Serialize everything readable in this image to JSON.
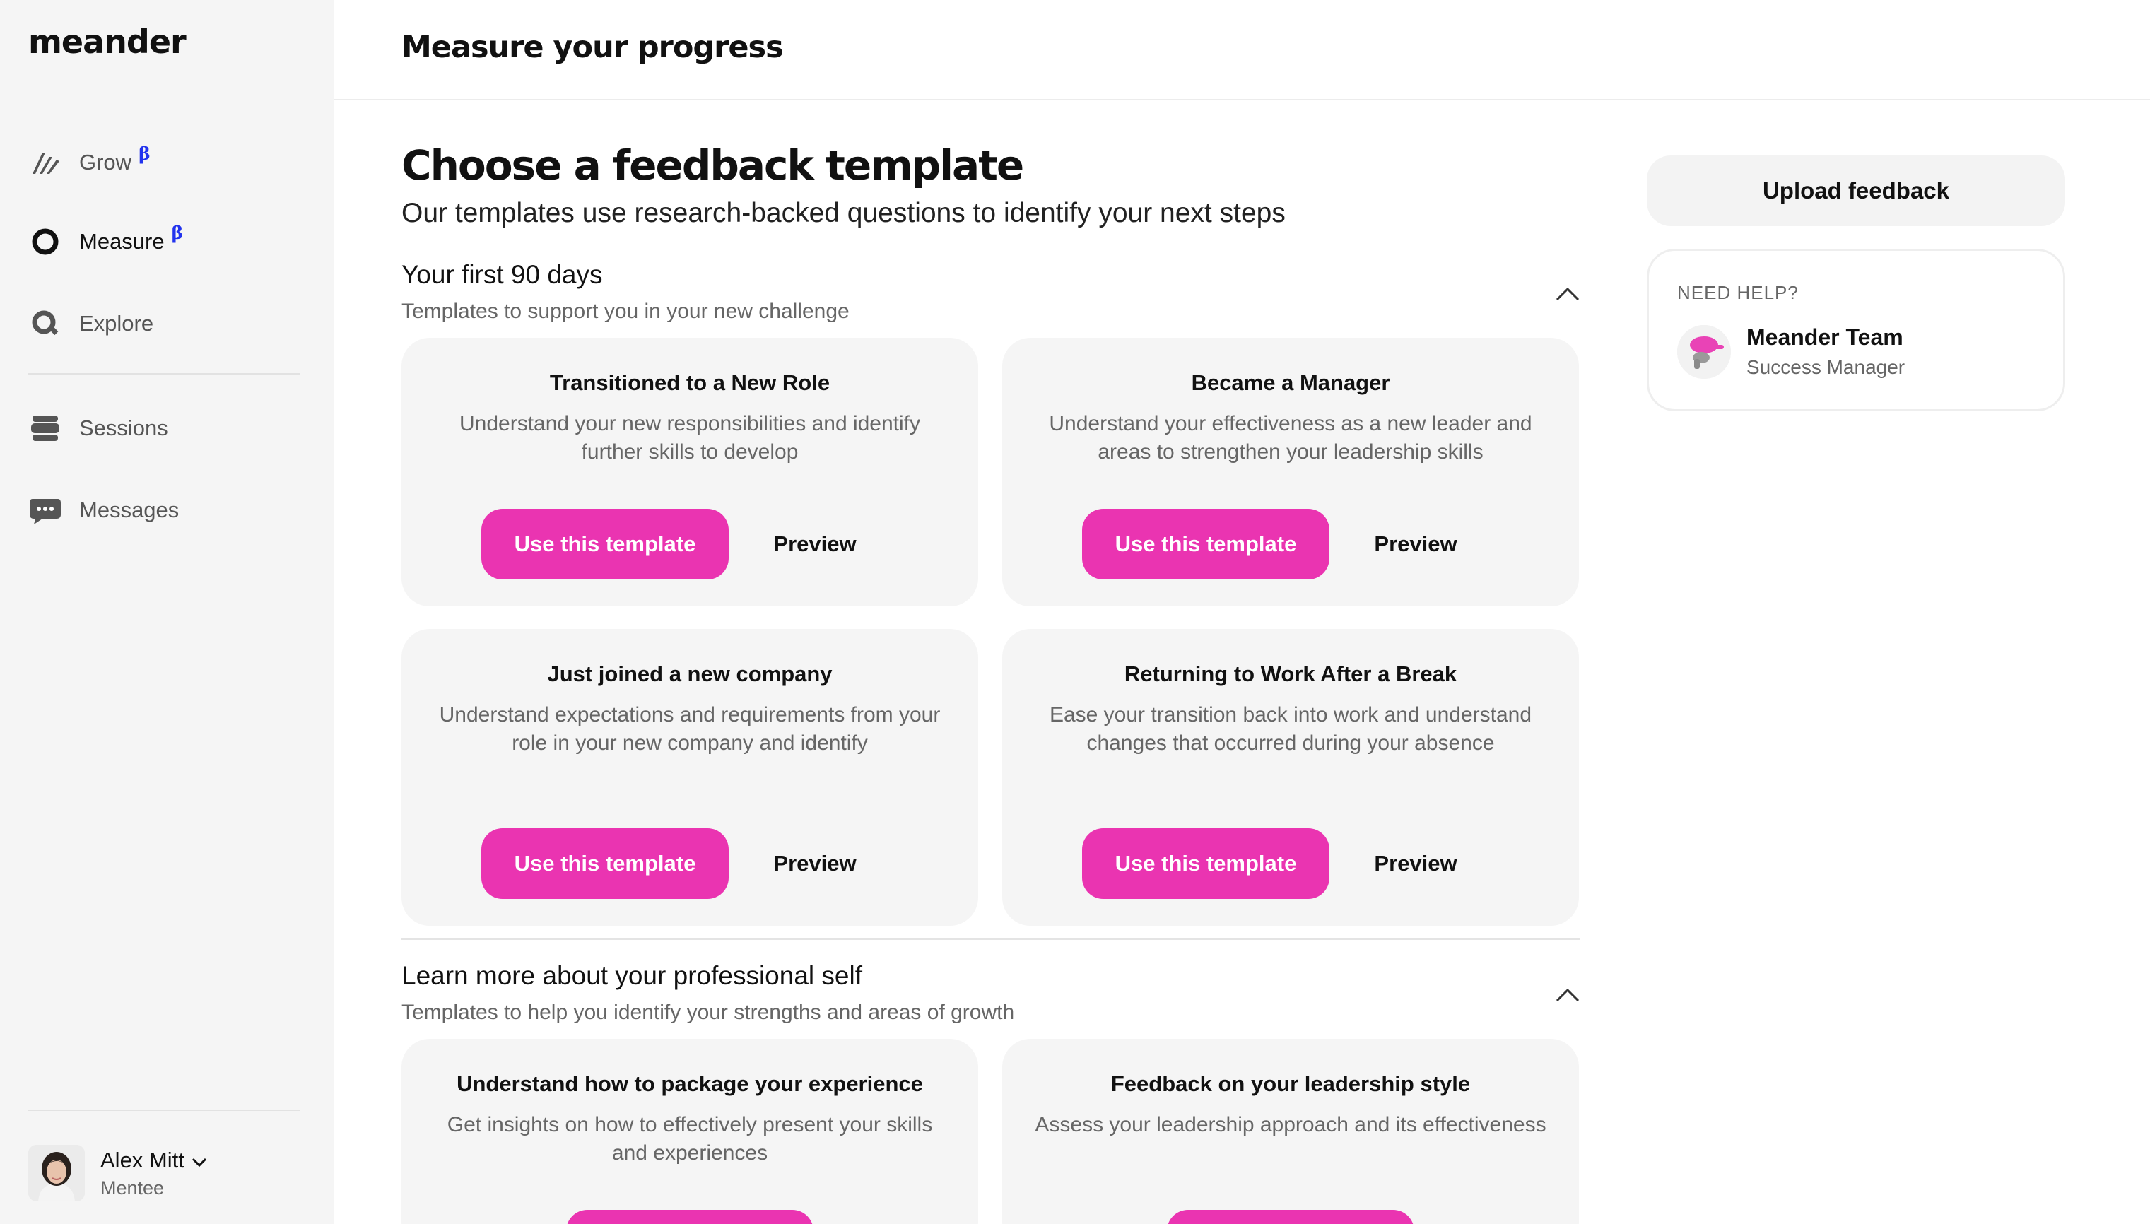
{
  "brand": {
    "logo": "meander",
    "accent": "#ea34b1",
    "beta_color": "#2233ee"
  },
  "sidebar": {
    "items": [
      {
        "label": "Grow",
        "icon": "grow-icon",
        "beta": "β",
        "active": false
      },
      {
        "label": "Measure",
        "icon": "measure-ring-icon",
        "beta": "β",
        "active": true
      },
      {
        "label": "Explore",
        "icon": "search-icon",
        "active": false
      },
      {
        "label": "Sessions",
        "icon": "sessions-icon",
        "active": false
      },
      {
        "label": "Messages",
        "icon": "chat-bubble-icon",
        "active": false
      }
    ],
    "profile": {
      "name": "Alex Mitt",
      "role": "Mentee"
    }
  },
  "header": {
    "title": "Measure your progress"
  },
  "main": {
    "title": "Choose a feedback template",
    "subtitle": "Our templates use research-backed questions to identify your next steps",
    "sections": [
      {
        "title": "Your first 90 days",
        "description": "Templates to support you in your new challenge",
        "cards": [
          {
            "title": "Transitioned to a New Role",
            "description": "Understand your new responsibilities and identify further skills to develop",
            "use_label": "Use this template",
            "preview_label": "Preview"
          },
          {
            "title": "Became a Manager",
            "description": "Understand your effectiveness as a new leader and areas to strengthen your leadership skills",
            "use_label": "Use this template",
            "preview_label": "Preview"
          },
          {
            "title": "Just joined a new company",
            "description": "Understand expectations and requirements from your role in your new company and identify",
            "use_label": "Use this template",
            "preview_label": "Preview"
          },
          {
            "title": "Returning to Work After a Break",
            "description": "Ease your transition back into work and understand changes that occurred during your absence",
            "use_label": "Use this template",
            "preview_label": "Preview"
          }
        ]
      },
      {
        "title": "Learn more about your professional self",
        "description": "Templates to help you identify your strengths and areas of growth",
        "cards": [
          {
            "title": "Understand how to package your experience",
            "description": "Get insights on how to effectively present your skills and experiences"
          },
          {
            "title": "Feedback on your leadership style",
            "description": "Assess your leadership approach and its effectiveness"
          }
        ]
      }
    ]
  },
  "right": {
    "upload_label": "Upload feedback",
    "help": {
      "label": "NEED HELP?",
      "name": "Meander Team",
      "role": "Success Manager"
    }
  }
}
